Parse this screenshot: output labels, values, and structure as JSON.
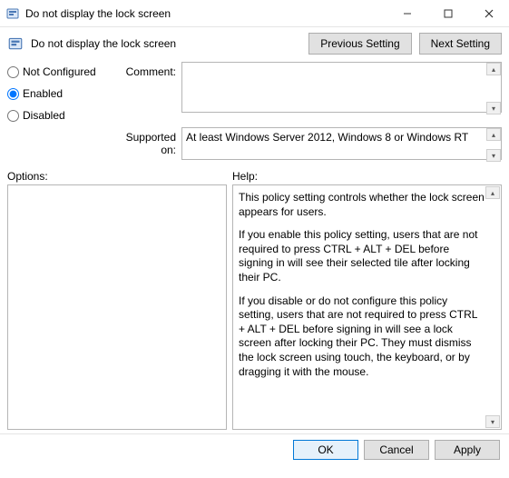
{
  "window": {
    "title": "Do not display the lock screen"
  },
  "header": {
    "title": "Do not display the lock screen",
    "prev_button": "Previous Setting",
    "next_button": "Next Setting"
  },
  "state": {
    "not_configured_label": "Not Configured",
    "enabled_label": "Enabled",
    "disabled_label": "Disabled",
    "selected": "Enabled"
  },
  "labels": {
    "comment": "Comment:",
    "supported_on": "Supported on:",
    "options": "Options:",
    "help": "Help:"
  },
  "fields": {
    "comment_value": "",
    "supported_on_value": "At least Windows Server 2012, Windows 8 or Windows RT"
  },
  "help": {
    "p1": "This policy setting controls whether the lock screen appears for users.",
    "p2": "If you enable this policy setting, users that are not required to press CTRL + ALT + DEL before signing in will see their selected tile after locking their PC.",
    "p3": "If you disable or do not configure this policy setting, users that are not required to press CTRL + ALT + DEL before signing in will see a lock screen after locking their PC. They must dismiss the lock screen using touch, the keyboard, or by dragging it with the mouse."
  },
  "footer": {
    "ok": "OK",
    "cancel": "Cancel",
    "apply": "Apply"
  }
}
